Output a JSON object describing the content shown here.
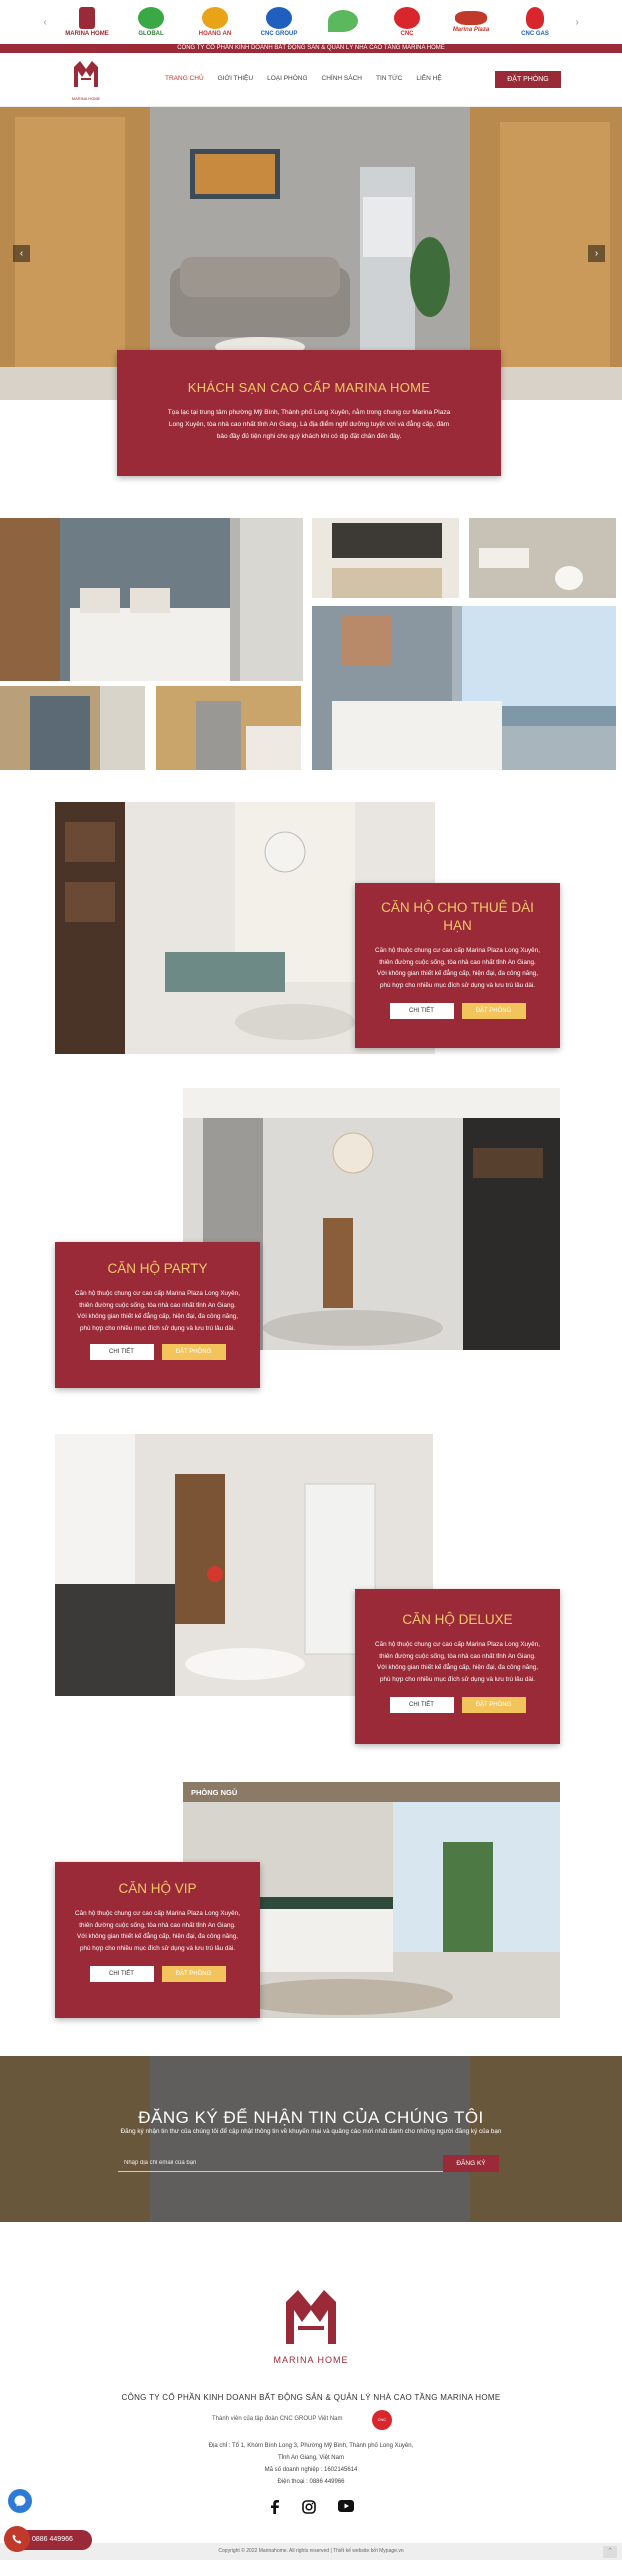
{
  "partners": [
    "MARINA HOME",
    "GLOBAL",
    "HOANG AN",
    "CNC GROUP",
    "",
    "CNC",
    "Marina Plaza",
    "CNC GAS"
  ],
  "top_strip": "CÔNG TY CỔ PHẦN KINH DOANH BẤT ĐỘNG SẢN & QUẢN LÝ NHÀ CAO TẦNG MARINA HOME",
  "header": {
    "brand": "MARINA HOME",
    "nav": [
      "TRANG CHỦ",
      "GIỚI THIỆU",
      "LOẠI PHÒNG",
      "CHÍNH SÁCH",
      "TIN TỨC",
      "LIÊN HỆ"
    ],
    "book": "ĐẶT PHÒNG"
  },
  "hero": {
    "prev": "‹",
    "next": "›",
    "title": "KHÁCH SẠN CAO CẤP MARINA HOME",
    "desc": "Tọa lạc tại trung tâm phường Mỹ Bình, Thành phố Long Xuyên, nằm trong chung cư Marina Plaza Long Xuyên, tòa nhà cao nhất tỉnh An Giang, Là địa điểm nghỉ dưỡng tuyệt vời và đẳng cấp, đảm bảo đầy đủ tiện nghi cho quý khách khi có dịp đặt chân đến đây."
  },
  "apartments": [
    {
      "title": "CĂN HỘ CHO THUÊ DÀI HẠN",
      "desc": "Căn hộ thuộc chung cư cao cấp Marina Plaza Long Xuyên, thiên đường cuộc sống, tòa nhà cao nhất tỉnh An Giang. Với không gian thiết kế đẳng cấp, hiện đại, đa công năng, phù hợp cho nhiều mục đích sử dụng và lưu trú lâu dài.",
      "detail": "CHI TIẾT",
      "book": "ĐẶT PHÒNG"
    },
    {
      "title": "CĂN HỘ PARTY",
      "desc": "Căn hộ thuộc chung cư cao cấp Marina Plaza Long Xuyên, thiên đường cuộc sống, tòa nhà cao nhất tỉnh An Giang. Với không gian thiết kế đẳng cấp, hiện đại, đa công năng, phù hợp cho nhiều mục đích sử dụng và lưu trú lâu dài.",
      "detail": "CHI TIẾT",
      "book": "ĐẶT PHÒNG"
    },
    {
      "title": "CĂN HỘ DELUXE",
      "desc": "Căn hộ thuộc chung cư cao cấp Marina Plaza Long Xuyên, thiên đường cuộc sống, tòa nhà cao nhất tỉnh An Giang. Với không gian thiết kế đẳng cấp, hiện đại, đa công năng, phù hợp cho nhiều mục đích sử dụng và lưu trú lâu dài.",
      "detail": "CHI TIẾT",
      "book": "ĐẶT PHÒNG"
    },
    {
      "title": "CĂN HỘ VIP",
      "desc": "Căn hộ thuộc chung cư cao cấp Marina Plaza Long Xuyên, thiên đường cuộc sống, tòa nhà cao nhất tỉnh An Giang. Với không gian thiết kế đẳng cấp, hiện đại, đa công năng, phù hợp cho nhiều mục đích sử dụng và lưu trú lâu dài.",
      "detail": "CHI TIẾT",
      "book": "ĐẶT PHÒNG",
      "photo_label": "PHÒNG NGỦ"
    }
  ],
  "newsletter": {
    "title": "ĐĂNG KÝ ĐỂ NHẬN TIN CỦA CHÚNG TÔI",
    "sub": "Đăng ký nhận tin thư của chúng tôi để cập nhật thông tin về khuyến mại và quảng cáo mới nhất dành cho những người đăng ký của bạn",
    "placeholder": "Nhập địa chỉ email của bạn",
    "button": "ĐĂNG KÝ"
  },
  "footer": {
    "brand": "MARINA HOME",
    "company": "CÔNG TY CỔ PHẦN KINH DOANH BẤT ĐỘNG SẢN & QUẢN LÝ NHÀ CAO TẦNG MARINA HOME",
    "member": "Thành viên của tập đoàn CNC GROUP Việt Nam",
    "member_logo": "CNC",
    "address1": "Địa chỉ : Tổ 1, Khóm Bình Long 3, Phường Mỹ Bình, Thành phố Long Xuyên,",
    "address2": "Tỉnh An Giang, Việt Nam",
    "tax": "Mã số doanh nghiệp : 1602145614",
    "phone": "Điện thoại : 0886 449966",
    "copyright": "Copyright © 2022 Marinahome. All rights reserved | Thiết kế website bởi Mypage.vn"
  },
  "widgets": {
    "phone": "0886 449966",
    "up": "⌃"
  },
  "colors": {
    "brand": "#9a2a37",
    "gold": "#f4c96a",
    "button_gold": "#f4c45c"
  }
}
